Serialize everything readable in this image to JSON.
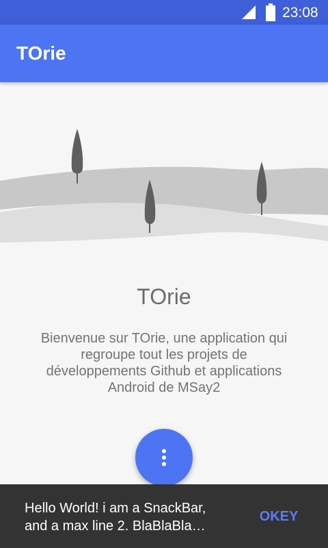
{
  "status_bar": {
    "time": "23:08",
    "signal_icon": "cell-signal-icon",
    "battery_icon": "battery-full-icon"
  },
  "app_bar": {
    "title": "TOrie"
  },
  "welcome": {
    "title": "TOrie",
    "description": "Bienvenue sur TOrie, une application qui regroupe tout les projets de développements Github et applications Android de MSay2"
  },
  "fab": {
    "icon": "more-vert-icon"
  },
  "snackbar": {
    "message": "Hello World! i am a SnackBar, and a max line 2. BlaBlaBla…",
    "action_label": "OKEY"
  },
  "colors": {
    "status_bar": "#3f5fd8",
    "primary": "#4d74f3",
    "background": "#f6f6f6",
    "snackbar_bg": "#333333",
    "snackbar_action": "#5b7cf6"
  }
}
